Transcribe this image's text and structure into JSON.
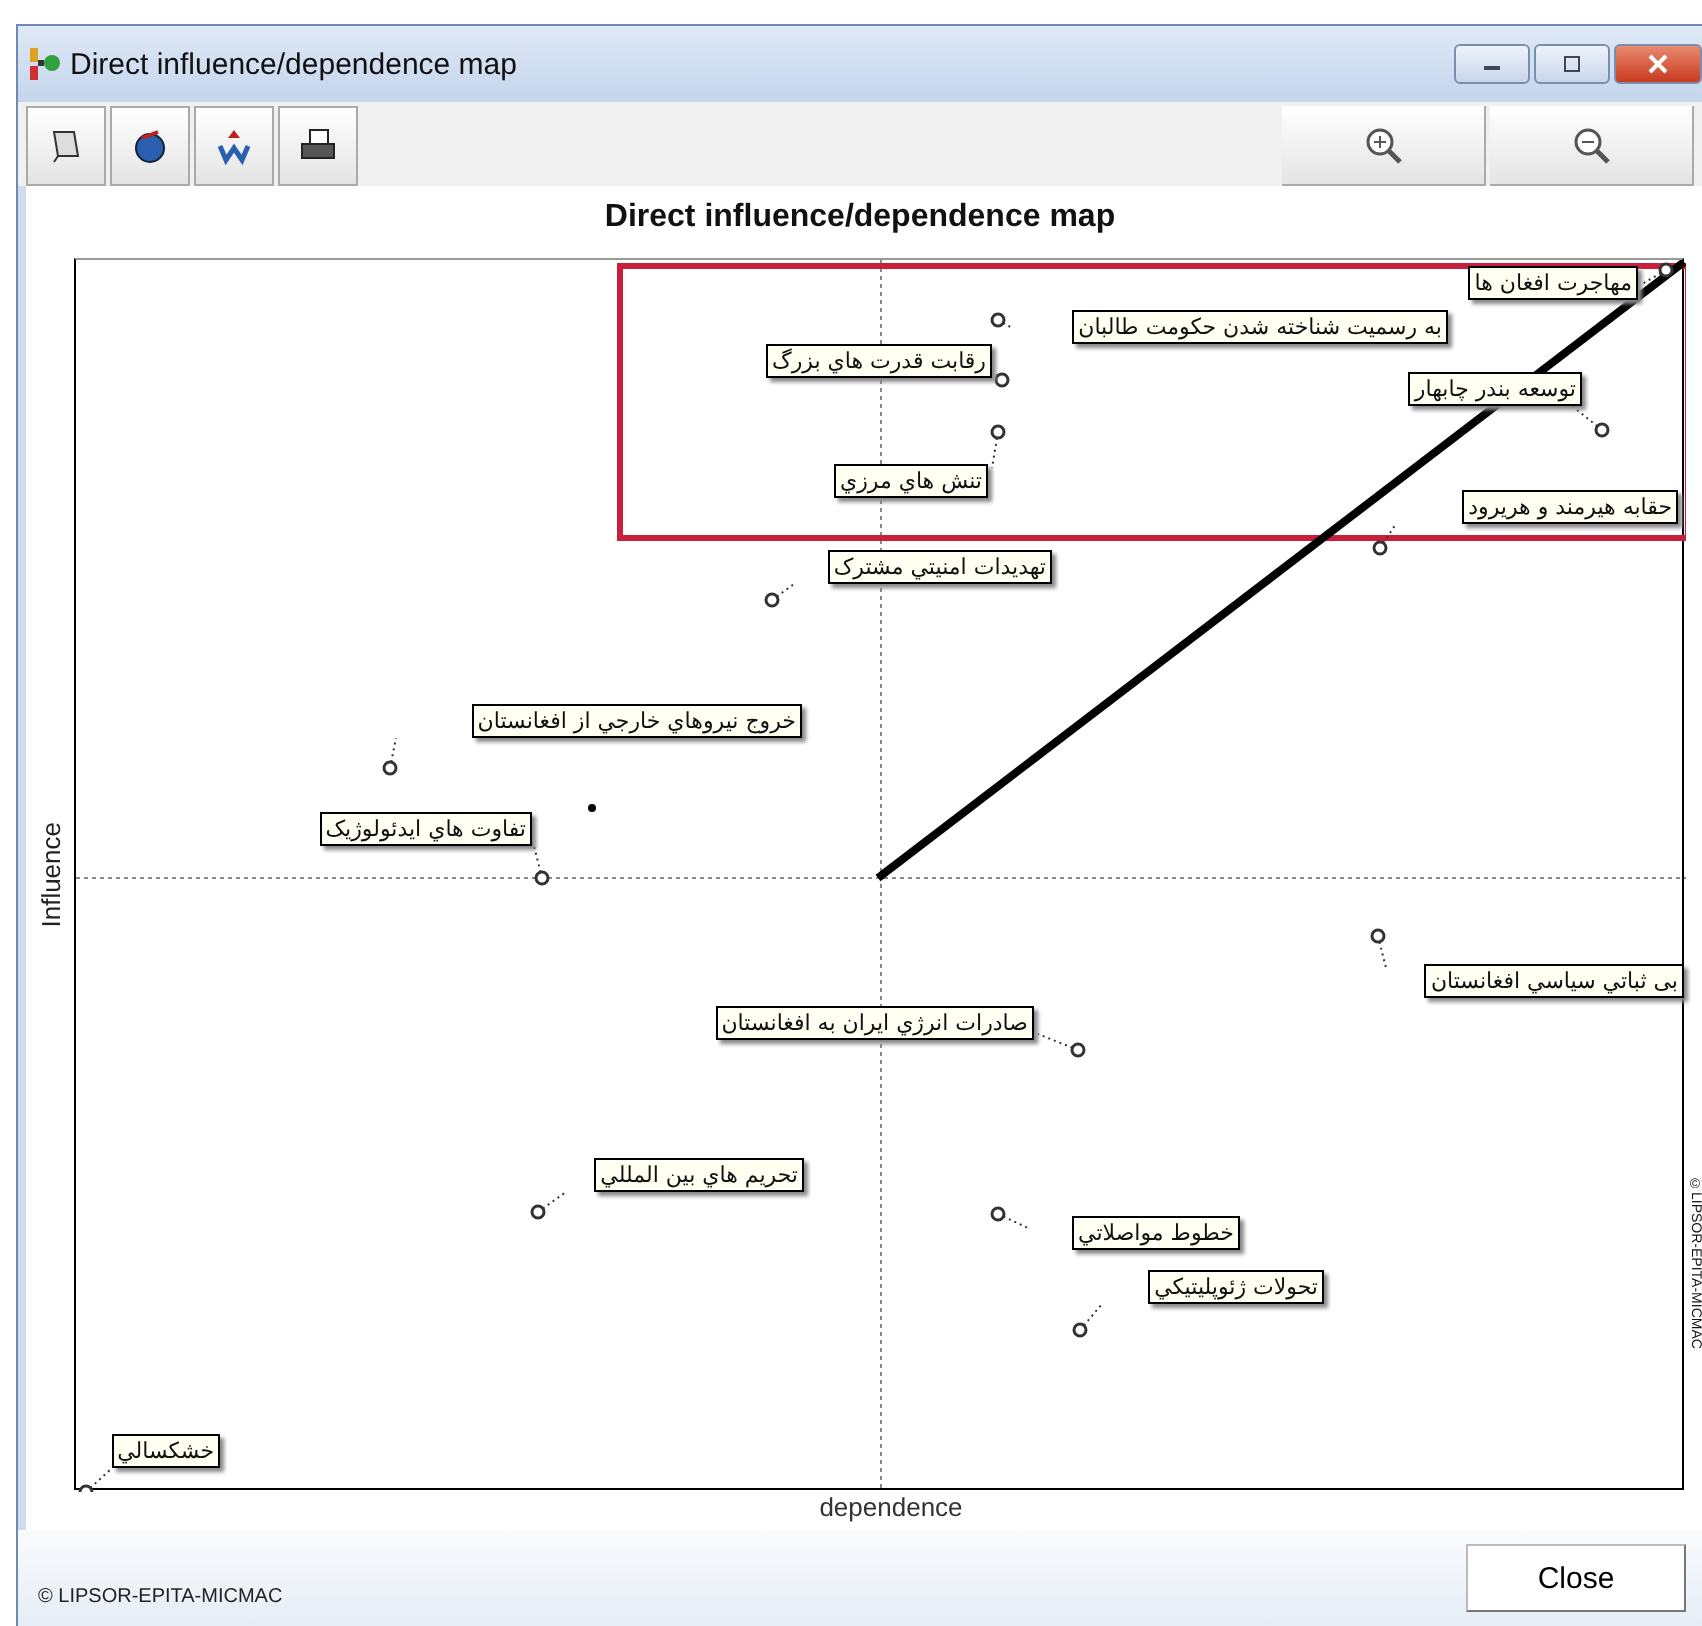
{
  "window": {
    "title": "Direct influence/dependence map"
  },
  "chart": {
    "title": "Direct influence/dependence map",
    "ylabel": "Influence",
    "xlabel": "dependence",
    "side_note": "©LIPSOR-EPITA-MICMAC",
    "variables": [
      {
        "label": "مهاجرت افغان ها"
      },
      {
        "label": "به رسمیت شناخته شدن حکومت طالبان"
      },
      {
        "label": "رقابت قدرت هاي بزرگ"
      },
      {
        "label": "توسعه بندر چابهار"
      },
      {
        "label": "تنش هاي مرزي"
      },
      {
        "label": "حقابه هیرمند و هریرود"
      },
      {
        "label": "تهدیدات امنیتي مشترک"
      },
      {
        "label": "خروج نیروهاي خارجي از افغانستان"
      },
      {
        "label": "تفاوت هاي ایدئولوژیک"
      },
      {
        "label": "بی ثباتي سیاسي افغانستان"
      },
      {
        "label": "صادرات انرژي ایران به افغانستان"
      },
      {
        "label": "تحریم هاي بین المللي"
      },
      {
        "label": "خطوط مواصلاتي"
      },
      {
        "label": "تحولات ژئوپلیتیکي"
      },
      {
        "label": "خشکسالي"
      }
    ]
  },
  "footer": {
    "copyright": "© LIPSOR-EPITA-MICMAC",
    "buttons": [
      "Close"
    ]
  }
}
